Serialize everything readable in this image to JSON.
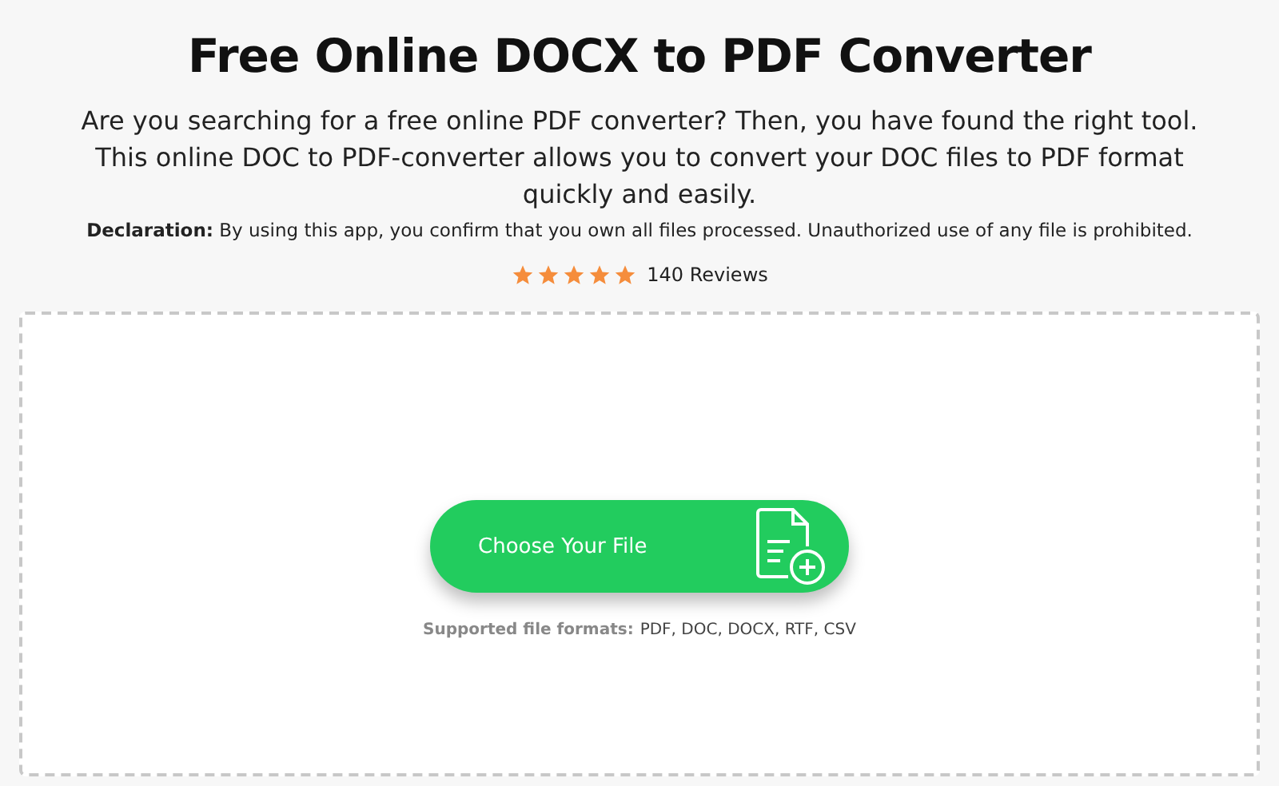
{
  "title": "Free Online DOCX to PDF Converter",
  "intro": "Are you searching for a free online PDF converter? Then, you have found the right tool. This online DOC to PDF-converter allows you to convert your DOC files to PDF format quickly and easily.",
  "declaration": "**Declaration:** By using this app, you confirm that you own all files processed. Unauthorized use of any file is prohibited.",
  "rating": {
    "stars": 5,
    "reviews": "140 Reviews"
  },
  "upload": {
    "button": "Choose Your File",
    "formats_label": "Supported file formats:",
    "formats": "PDF, DOC, DOCX, RTF, CSV"
  }
}
